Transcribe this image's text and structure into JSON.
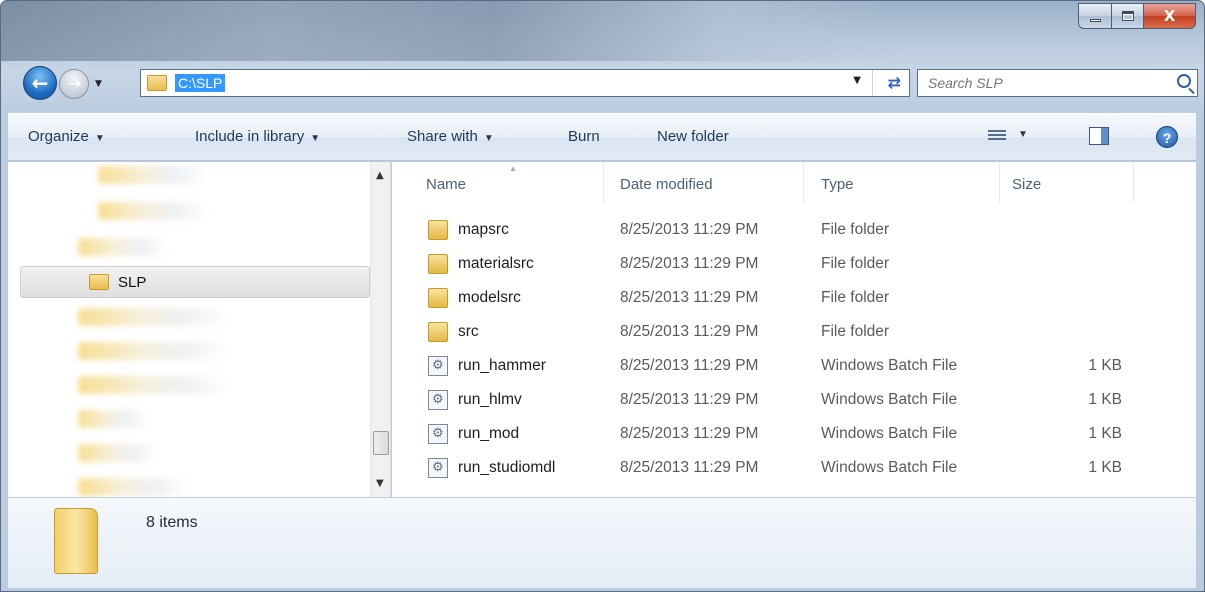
{
  "window": {
    "caption_buttons": {
      "minimize": "",
      "maximize": "",
      "close": "X"
    }
  },
  "nav": {
    "back_icon": "back-arrow-icon",
    "forward_icon": "forward-arrow-icon"
  },
  "address": {
    "path": "C:\\SLP"
  },
  "search": {
    "placeholder": "Search SLP"
  },
  "commands": {
    "organize": "Organize",
    "include_in_library": "Include in library",
    "share_with": "Share with",
    "burn": "Burn",
    "new_folder": "New folder"
  },
  "navpane": {
    "selected_label": "SLP"
  },
  "columns": {
    "name": "Name",
    "date": "Date modified",
    "type": "Type",
    "size": "Size"
  },
  "files": [
    {
      "name": "mapsrc",
      "date": "8/25/2013 11:29 PM",
      "type": "File folder",
      "size": "",
      "icon": "folder"
    },
    {
      "name": "materialsrc",
      "date": "8/25/2013 11:29 PM",
      "type": "File folder",
      "size": "",
      "icon": "folder"
    },
    {
      "name": "modelsrc",
      "date": "8/25/2013 11:29 PM",
      "type": "File folder",
      "size": "",
      "icon": "folder"
    },
    {
      "name": "src",
      "date": "8/25/2013 11:29 PM",
      "type": "File folder",
      "size": "",
      "icon": "folder"
    },
    {
      "name": "run_hammer",
      "date": "8/25/2013 11:29 PM",
      "type": "Windows Batch File",
      "size": "1 KB",
      "icon": "batch"
    },
    {
      "name": "run_hlmv",
      "date": "8/25/2013 11:29 PM",
      "type": "Windows Batch File",
      "size": "1 KB",
      "icon": "batch"
    },
    {
      "name": "run_mod",
      "date": "8/25/2013 11:29 PM",
      "type": "Windows Batch File",
      "size": "1 KB",
      "icon": "batch"
    },
    {
      "name": "run_studiomdl",
      "date": "8/25/2013 11:29 PM",
      "type": "Windows Batch File",
      "size": "1 KB",
      "icon": "batch"
    }
  ],
  "details": {
    "item_count": "8 items"
  }
}
